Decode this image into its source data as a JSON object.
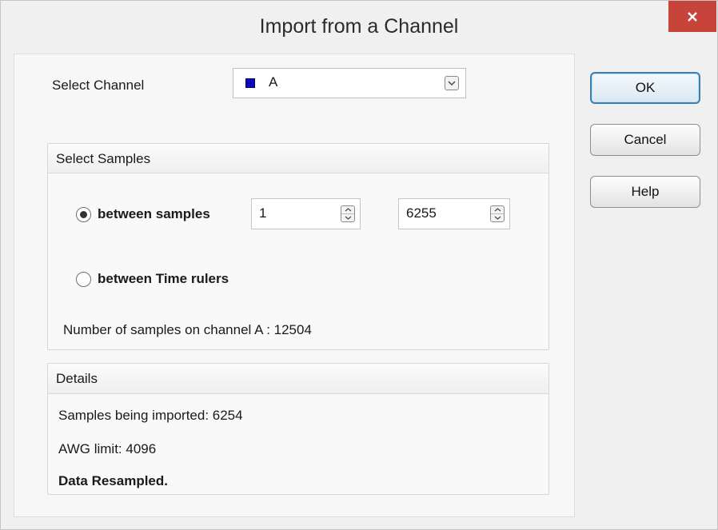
{
  "window": {
    "title": "Import from a Channel",
    "close_glyph": "×"
  },
  "channel": {
    "label": "Select Channel",
    "selected": "A",
    "swatch_color": "#0a0ab8"
  },
  "select_samples": {
    "title": "Select Samples",
    "option_between_samples": "between samples",
    "start_value": "1",
    "end_value": "6255",
    "option_time_rulers": "between Time rulers",
    "selected_option": "between samples",
    "count_text": "Number of samples on channel A : 12504"
  },
  "details": {
    "title": "Details",
    "imported": "Samples being imported: 6254",
    "awg_limit": "AWG limit: 4096",
    "status": "Data Resampled."
  },
  "buttons": {
    "ok": "OK",
    "cancel": "Cancel",
    "help": "Help"
  },
  "icons": [
    "close-icon",
    "chevron-down-icon",
    "spin-up-icon",
    "spin-down-icon",
    "color-swatch-icon"
  ]
}
